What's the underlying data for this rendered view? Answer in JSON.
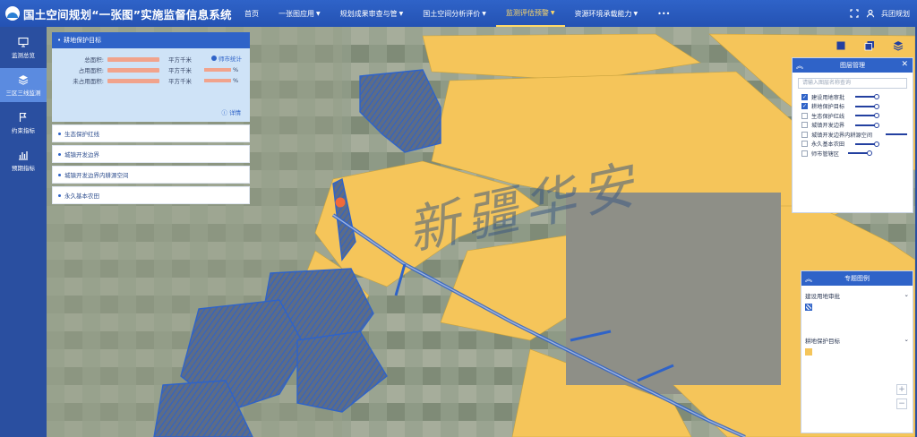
{
  "app": {
    "title": "国土空间规划“一张图”实施监督信息系统"
  },
  "nav": {
    "items": [
      {
        "label": "首页",
        "caret": false,
        "active": false
      },
      {
        "label": "一张图应用",
        "caret": true,
        "active": false
      },
      {
        "label": "规划成果审查与管",
        "caret": true,
        "active": false
      },
      {
        "label": "国土空间分析评价",
        "caret": true,
        "active": false
      },
      {
        "label": "监测评估预警",
        "caret": true,
        "active": true
      },
      {
        "label": "资源环境承载能力",
        "caret": true,
        "active": false
      }
    ],
    "more": "•••",
    "user": "兵团规划"
  },
  "sidebar": {
    "items": [
      {
        "label": "监测总览",
        "icon": "monitor-icon",
        "active": false
      },
      {
        "label": "三区三线监测",
        "icon": "layers-icon",
        "active": true
      },
      {
        "label": "约束指标",
        "icon": "flag-icon",
        "active": false
      },
      {
        "label": "预期指标",
        "icon": "bar-chart-icon",
        "active": false
      }
    ]
  },
  "query_panel": {
    "header": "耕地保护目标",
    "stats": [
      {
        "label": "总面积:",
        "unit": "平方千米",
        "pct": ""
      },
      {
        "label": "占用面积:",
        "unit": "平方千米",
        "pct": "%"
      },
      {
        "label": "未占用面积:",
        "unit": "平方千米",
        "pct": "%"
      }
    ],
    "filter_label": "师市统计",
    "detail_link": "详情",
    "rows": [
      "生态保护红线",
      "城镇开发边界",
      "城镇开发边界内耕源空间",
      "永久基本农田"
    ]
  },
  "layer_panel": {
    "title": "图层管理",
    "search_placeholder": "请输入图层名称查询",
    "layers": [
      {
        "label": "建设用地审批",
        "checked": true
      },
      {
        "label": "耕地保护目标",
        "checked": true
      },
      {
        "label": "生态保护红线",
        "checked": false
      },
      {
        "label": "城镇开发边界",
        "checked": false
      },
      {
        "label": "城镇开发边界内耕源空间",
        "checked": false
      },
      {
        "label": "永久基本农田",
        "checked": false
      },
      {
        "label": "师市管辖区",
        "checked": false
      }
    ]
  },
  "legend_panel": {
    "title": "专题图例",
    "groups": [
      {
        "label": "建设用地审批",
        "color": "#2f63c8",
        "pattern": "hatch"
      },
      {
        "label": "耕地保护目标",
        "color": "#f5c55a",
        "pattern": "solid"
      }
    ],
    "zoom_in": "+",
    "zoom_out": "−"
  },
  "map": {
    "watermark": "新疆华安",
    "colors": {
      "farmland": "#f5c55a",
      "approval": "#2f63c8",
      "base": "#8c9684"
    }
  }
}
